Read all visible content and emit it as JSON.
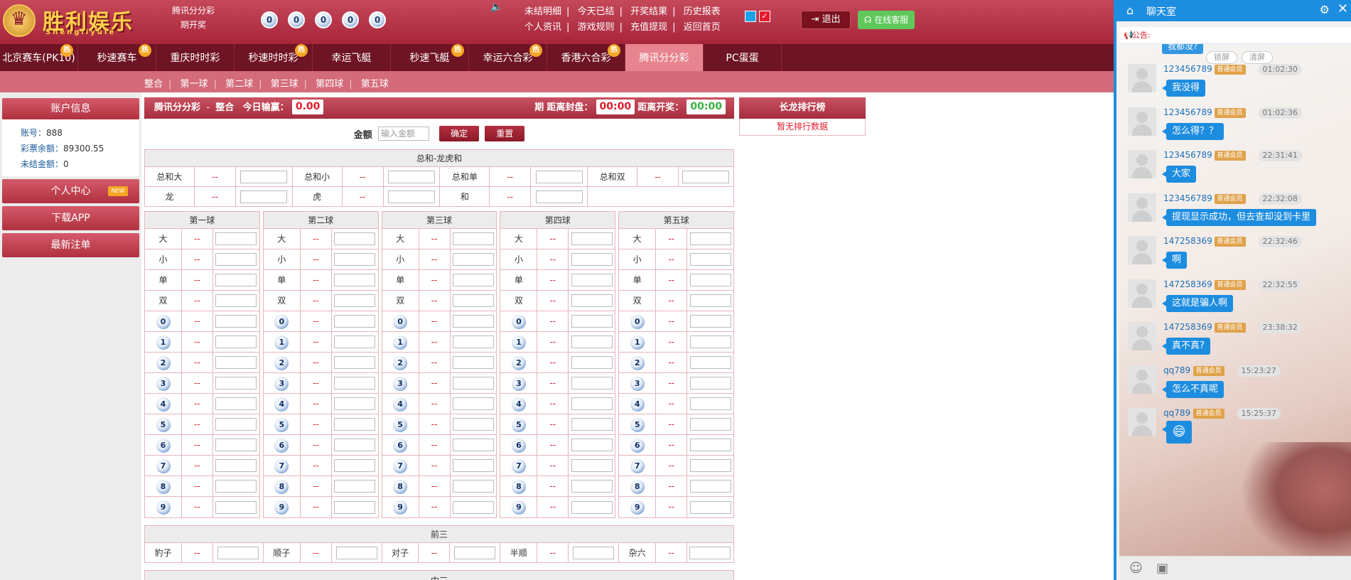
{
  "header": {
    "logo_text": "胜利娱乐",
    "logo_sub": "Shengliyule",
    "game_name": "腾讯分分彩",
    "period_label": "期开奖",
    "balls": [
      "0",
      "0",
      "0",
      "0",
      "0"
    ],
    "links_row1": [
      "未结明细",
      "今天已结",
      "开奖结果",
      "历史报表"
    ],
    "links_row2": [
      "个人资讯",
      "游戏规则",
      "充值提现",
      "返回首页"
    ],
    "logout_label": "退出",
    "service_label": "在线客服"
  },
  "nav": {
    "items": [
      {
        "label": "北京赛车(PK10)",
        "hot": true
      },
      {
        "label": "秒速赛车",
        "hot": true
      },
      {
        "label": "重庆时时彩",
        "hot": false
      },
      {
        "label": "秒速时时彩",
        "hot": true
      },
      {
        "label": "幸运飞艇",
        "hot": false
      },
      {
        "label": "秒速飞艇",
        "hot": true
      },
      {
        "label": "幸运六合彩",
        "hot": true
      },
      {
        "label": "香港六合彩",
        "hot": true
      },
      {
        "label": "腾讯分分彩",
        "hot": false
      },
      {
        "label": "PC蛋蛋",
        "hot": false
      }
    ],
    "active": "腾讯分分彩",
    "hot_label": "热"
  },
  "subnav": {
    "items": [
      "整合",
      "第一球",
      "第二球",
      "第三球",
      "第四球",
      "第五球"
    ]
  },
  "sidebar": {
    "account_title": "账户信息",
    "account_label": "账号：",
    "account_value": "888",
    "balance_label": "彩票余额：",
    "balance_value": "89300.55",
    "unsettled_label": "未结金额：",
    "unsettled_value": "0",
    "personal_center": "个人中心",
    "new_badge": "NEW",
    "download_app": "下载APP",
    "latest_bets": "最新注单"
  },
  "titlebar": {
    "game": "腾讯分分彩",
    "dash": "-",
    "mode": "整合",
    "profit_label": "今日输赢：",
    "profit_value": "0.00",
    "period_text": "期",
    "close_label": "距离封盘：",
    "close_value": "00:00",
    "open_label": "距离开奖：",
    "open_value": "00:00"
  },
  "amount": {
    "label": "金额",
    "placeholder": "输入金额",
    "confirm": "确定",
    "reset": "重置"
  },
  "sum_table": {
    "title": "总和-龙虎和",
    "row1": [
      "总和大",
      "总和小",
      "总和单",
      "总和双"
    ],
    "row2": [
      "龙",
      "虎",
      "和"
    ],
    "odds": "--"
  },
  "ball_columns": {
    "titles": [
      "第一球",
      "第二球",
      "第三球",
      "第四球",
      "第五球"
    ],
    "text_options": [
      "大",
      "小",
      "单",
      "双"
    ],
    "numbers": [
      "0",
      "1",
      "2",
      "3",
      "4",
      "5",
      "6",
      "7",
      "8",
      "9"
    ],
    "odds": "--"
  },
  "qiansan": {
    "title": "前三",
    "items": [
      "豹子",
      "顺子",
      "对子",
      "半顺",
      "杂六"
    ],
    "odds": "--"
  },
  "zhongsan": {
    "title": "中三"
  },
  "dragon": {
    "title": "长龙排行榜",
    "empty": "暂无排行数据"
  },
  "chat": {
    "title": "聊天室",
    "notice_label": "公告:",
    "scroll_lock": "锁屏",
    "clear_screen": "清屏",
    "first_partial": "我都没?",
    "vip_label": "普通会员",
    "messages": [
      {
        "user": "123456789",
        "time": "01:02:30",
        "text": "我没得"
      },
      {
        "user": "123456789",
        "time": "01:02:36",
        "text": "怎么得？？"
      },
      {
        "user": "123456789",
        "time": "22:31:41",
        "text": "大家"
      },
      {
        "user": "123456789",
        "time": "22:32:08",
        "text": "提现显示成功，但去查却没到卡里"
      },
      {
        "user": "147258369",
        "time": "22:32:46",
        "text": "啊"
      },
      {
        "user": "147258369",
        "time": "22:32:55",
        "text": "这就是骗人啊"
      },
      {
        "user": "147258369",
        "time": "23:38:32",
        "text": "真不真?"
      },
      {
        "user": "qq789",
        "time": "15:23:27",
        "text": "怎么不真呢"
      },
      {
        "user": "qq789",
        "time": "15:25:37",
        "text": "😄"
      }
    ]
  }
}
